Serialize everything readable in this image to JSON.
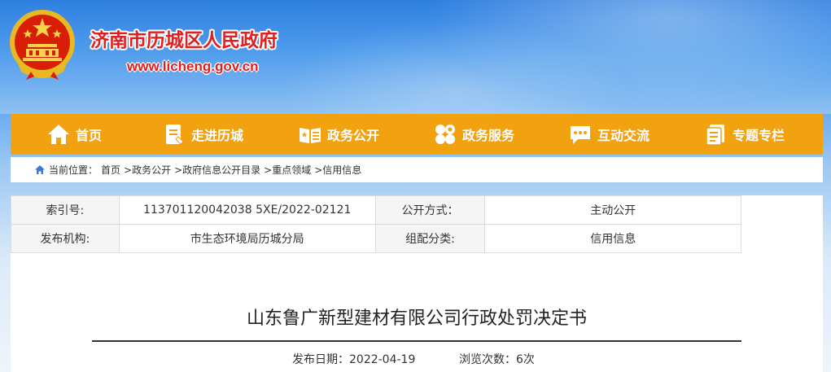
{
  "site": {
    "title": "济南市历城区人民政府",
    "url": "www.licheng.gov.cn"
  },
  "nav": [
    {
      "label": "首页",
      "icon": "home-icon"
    },
    {
      "label": "走进历城",
      "icon": "document-icon"
    },
    {
      "label": "政务公开",
      "icon": "open-book-icon"
    },
    {
      "label": "政务服务",
      "icon": "services-grid-icon"
    },
    {
      "label": "互动交流",
      "icon": "chat-bubble-icon"
    },
    {
      "label": "专题专栏",
      "icon": "stacked-pages-icon"
    }
  ],
  "breadcrumb": {
    "prefix": "当前位置：",
    "items": [
      "首页",
      ">政务公开",
      ">政府信息公开目录",
      ">重点领域",
      ">信用信息"
    ]
  },
  "meta": {
    "index_label": "索引号:",
    "index_value": "113701120042038 5XE/2022-02121",
    "open_mode_label": "公开方式：",
    "open_mode_value": "主动公开",
    "publisher_label": "发布机构:",
    "publisher_value": "市生态环境局历城分局",
    "category_label": "组配分类:",
    "category_value": "信用信息"
  },
  "document": {
    "title": "山东鲁广新型建材有限公司行政处罚决定书",
    "publish_date": "发布日期：2022-04-19",
    "view_count": "浏览次数：6次"
  }
}
